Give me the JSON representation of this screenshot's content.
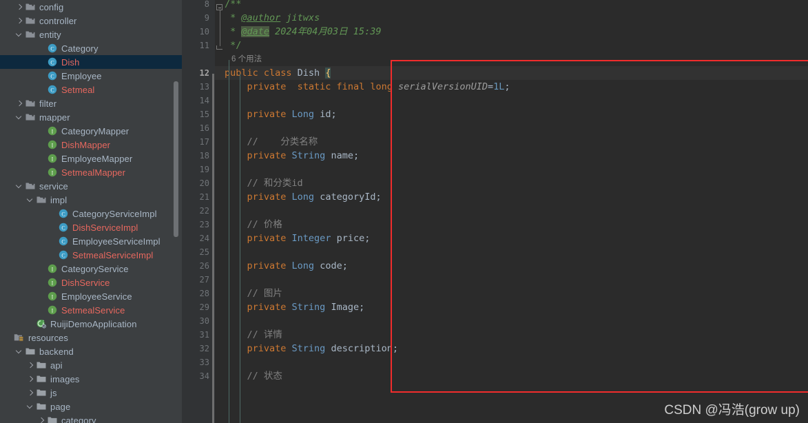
{
  "sidebar": {
    "items": [
      {
        "label": "config",
        "indent": 1,
        "arrow": "right",
        "icon": "package-folder-icon",
        "color": "c-default"
      },
      {
        "label": "controller",
        "indent": 1,
        "arrow": "right",
        "icon": "package-folder-icon",
        "color": "c-default"
      },
      {
        "label": "entity",
        "indent": 1,
        "arrow": "down",
        "icon": "package-folder-icon",
        "color": "c-default"
      },
      {
        "label": "Category",
        "indent": 3,
        "arrow": "none",
        "icon": "java-class-icon",
        "color": "c-default"
      },
      {
        "label": "Dish",
        "indent": 3,
        "arrow": "none",
        "icon": "java-class-icon",
        "color": "c-red",
        "selected": true
      },
      {
        "label": "Employee",
        "indent": 3,
        "arrow": "none",
        "icon": "java-class-icon",
        "color": "c-default"
      },
      {
        "label": "Setmeal",
        "indent": 3,
        "arrow": "none",
        "icon": "java-class-icon",
        "color": "c-red"
      },
      {
        "label": "filter",
        "indent": 1,
        "arrow": "right",
        "icon": "package-folder-icon",
        "color": "c-default"
      },
      {
        "label": "mapper",
        "indent": 1,
        "arrow": "down",
        "icon": "package-folder-icon",
        "color": "c-default"
      },
      {
        "label": "CategoryMapper",
        "indent": 3,
        "arrow": "none",
        "icon": "java-interface-icon",
        "color": "c-default"
      },
      {
        "label": "DishMapper",
        "indent": 3,
        "arrow": "none",
        "icon": "java-interface-icon",
        "color": "c-red"
      },
      {
        "label": "EmployeeMapper",
        "indent": 3,
        "arrow": "none",
        "icon": "java-interface-icon",
        "color": "c-default"
      },
      {
        "label": "SetmealMapper",
        "indent": 3,
        "arrow": "none",
        "icon": "java-interface-icon",
        "color": "c-red"
      },
      {
        "label": "service",
        "indent": 1,
        "arrow": "down",
        "icon": "package-folder-icon",
        "color": "c-default"
      },
      {
        "label": "impl",
        "indent": 2,
        "arrow": "down",
        "icon": "package-folder-icon",
        "color": "c-default"
      },
      {
        "label": "CategoryServiceImpl",
        "indent": 4,
        "arrow": "none",
        "icon": "java-class-icon",
        "color": "c-default"
      },
      {
        "label": "DishServiceImpl",
        "indent": 4,
        "arrow": "none",
        "icon": "java-class-icon",
        "color": "c-red"
      },
      {
        "label": "EmployeeServiceImpl",
        "indent": 4,
        "arrow": "none",
        "icon": "java-class-icon",
        "color": "c-default"
      },
      {
        "label": "SetmealServiceImpl",
        "indent": 4,
        "arrow": "none",
        "icon": "java-class-icon",
        "color": "c-red"
      },
      {
        "label": "CategoryService",
        "indent": 3,
        "arrow": "none",
        "icon": "java-interface-icon",
        "color": "c-default"
      },
      {
        "label": "DishService",
        "indent": 3,
        "arrow": "none",
        "icon": "java-interface-icon",
        "color": "c-red"
      },
      {
        "label": "EmployeeService",
        "indent": 3,
        "arrow": "none",
        "icon": "java-interface-icon",
        "color": "c-default"
      },
      {
        "label": "SetmealService",
        "indent": 3,
        "arrow": "none",
        "icon": "java-interface-icon",
        "color": "c-red"
      },
      {
        "label": "RuijiDemoApplication",
        "indent": 2,
        "arrow": "none",
        "icon": "spring-boot-app-icon",
        "color": "c-default"
      },
      {
        "label": "resources",
        "indent": 0,
        "arrow": "none",
        "icon": "resources-folder-icon",
        "color": "c-default"
      },
      {
        "label": "backend",
        "indent": 1,
        "arrow": "down",
        "icon": "folder-icon",
        "color": "c-default"
      },
      {
        "label": "api",
        "indent": 2,
        "arrow": "right",
        "icon": "folder-icon",
        "color": "c-default"
      },
      {
        "label": "images",
        "indent": 2,
        "arrow": "right",
        "icon": "folder-icon",
        "color": "c-default"
      },
      {
        "label": "js",
        "indent": 2,
        "arrow": "right",
        "icon": "folder-icon",
        "color": "c-default"
      },
      {
        "label": "page",
        "indent": 2,
        "arrow": "down",
        "icon": "folder-icon",
        "color": "c-default"
      },
      {
        "label": "category",
        "indent": 3,
        "arrow": "right",
        "icon": "folder-icon",
        "color": "c-default"
      }
    ]
  },
  "editor": {
    "code_vision_hint": "6 个用法",
    "current_line": 12,
    "lines": [
      {
        "n": 8,
        "tokens": [
          {
            "t": "/**",
            "c": "doc"
          }
        ]
      },
      {
        "n": 9,
        "tokens": [
          {
            "t": " * ",
            "c": "doc"
          },
          {
            "t": "@author",
            "c": "doctag"
          },
          {
            "t": " jitwxs",
            "c": "docit"
          }
        ]
      },
      {
        "n": 10,
        "tokens": [
          {
            "t": " * ",
            "c": "doc"
          },
          {
            "t": "@date",
            "c": "doctag-hl"
          },
          {
            "t": " 2024年04月03日 15:39",
            "c": "docit"
          }
        ]
      },
      {
        "n": 11,
        "tokens": [
          {
            "t": " */",
            "c": "doc"
          }
        ]
      },
      {
        "n": 12,
        "tokens": [
          {
            "t": "public class ",
            "c": "kw"
          },
          {
            "t": "Dish ",
            "c": "plain"
          },
          {
            "t": "{",
            "c": "brace-hl"
          }
        ]
      },
      {
        "n": 13,
        "tokens": [
          {
            "t": "    ",
            "c": "plain"
          },
          {
            "t": "private  static final ",
            "c": "kw"
          },
          {
            "t": "long ",
            "c": "kw"
          },
          {
            "t": "serialVersionUID",
            "c": "sv"
          },
          {
            "t": "=",
            "c": "plain"
          },
          {
            "t": "1L",
            "c": "num"
          },
          {
            "t": ";",
            "c": "plain"
          }
        ]
      },
      {
        "n": 14,
        "tokens": []
      },
      {
        "n": 15,
        "tokens": [
          {
            "t": "    ",
            "c": "plain"
          },
          {
            "t": "private ",
            "c": "kw"
          },
          {
            "t": "Long ",
            "c": "type"
          },
          {
            "t": "id;",
            "c": "plain"
          }
        ]
      },
      {
        "n": 16,
        "tokens": []
      },
      {
        "n": 17,
        "tokens": [
          {
            "t": "    //    分类名称",
            "c": "cmt"
          }
        ]
      },
      {
        "n": 18,
        "tokens": [
          {
            "t": "    ",
            "c": "plain"
          },
          {
            "t": "private ",
            "c": "kw"
          },
          {
            "t": "String ",
            "c": "type"
          },
          {
            "t": "name;",
            "c": "plain"
          }
        ]
      },
      {
        "n": 19,
        "tokens": []
      },
      {
        "n": 20,
        "tokens": [
          {
            "t": "    // 和分类id",
            "c": "cmt"
          }
        ]
      },
      {
        "n": 21,
        "tokens": [
          {
            "t": "    ",
            "c": "plain"
          },
          {
            "t": "private ",
            "c": "kw"
          },
          {
            "t": "Long ",
            "c": "type"
          },
          {
            "t": "categoryId;",
            "c": "plain"
          }
        ]
      },
      {
        "n": 22,
        "tokens": []
      },
      {
        "n": 23,
        "tokens": [
          {
            "t": "    // 价格",
            "c": "cmt"
          }
        ]
      },
      {
        "n": 24,
        "tokens": [
          {
            "t": "    ",
            "c": "plain"
          },
          {
            "t": "private ",
            "c": "kw"
          },
          {
            "t": "Integer ",
            "c": "type"
          },
          {
            "t": "price;",
            "c": "plain"
          }
        ]
      },
      {
        "n": 25,
        "tokens": []
      },
      {
        "n": 26,
        "tokens": [
          {
            "t": "    ",
            "c": "plain"
          },
          {
            "t": "private ",
            "c": "kw"
          },
          {
            "t": "Long ",
            "c": "type"
          },
          {
            "t": "code;",
            "c": "plain"
          }
        ]
      },
      {
        "n": 27,
        "tokens": []
      },
      {
        "n": 28,
        "tokens": [
          {
            "t": "    // 图片",
            "c": "cmt"
          }
        ]
      },
      {
        "n": 29,
        "tokens": [
          {
            "t": "    ",
            "c": "plain"
          },
          {
            "t": "private ",
            "c": "kw"
          },
          {
            "t": "String ",
            "c": "type"
          },
          {
            "t": "Image;",
            "c": "plain"
          }
        ]
      },
      {
        "n": 30,
        "tokens": []
      },
      {
        "n": 31,
        "tokens": [
          {
            "t": "    // 详情",
            "c": "cmt"
          }
        ]
      },
      {
        "n": 32,
        "tokens": [
          {
            "t": "    ",
            "c": "plain"
          },
          {
            "t": "private ",
            "c": "kw"
          },
          {
            "t": "String ",
            "c": "type"
          },
          {
            "t": "description;",
            "c": "plain"
          }
        ]
      },
      {
        "n": 33,
        "tokens": []
      },
      {
        "n": 34,
        "tokens": [
          {
            "t": "    // 状态",
            "c": "cmt"
          }
        ]
      }
    ]
  },
  "annotation": {
    "highlight_box_color": "#F22C2C"
  },
  "watermark": {
    "text": "CSDN @冯浩(grow up)"
  }
}
